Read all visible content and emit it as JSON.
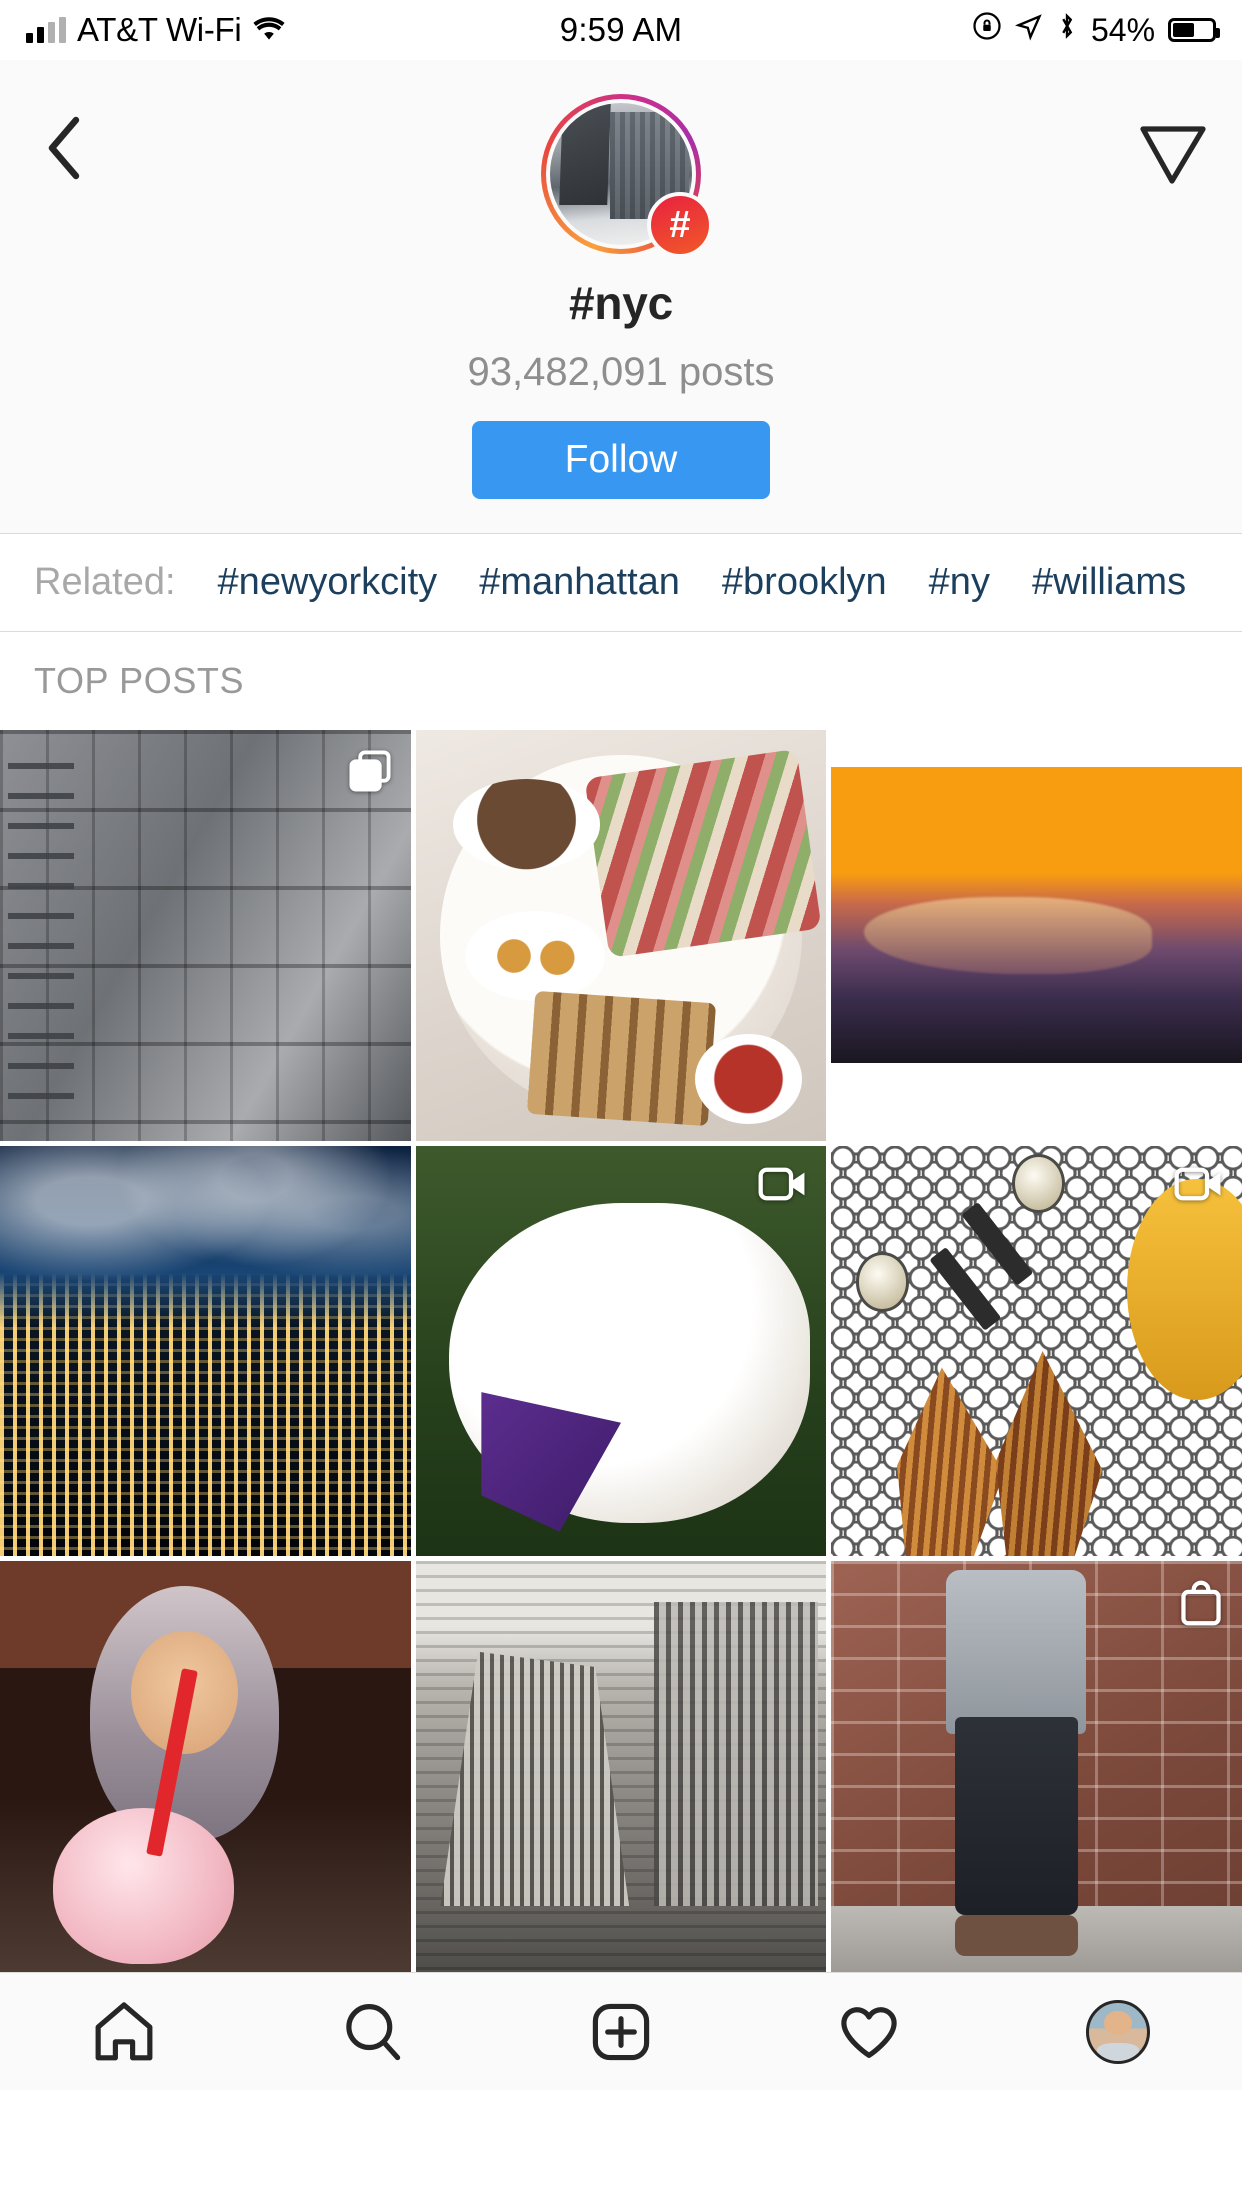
{
  "status_bar": {
    "carrier": "AT&T Wi-Fi",
    "time": "9:59 AM",
    "battery_percent": "54%",
    "icons": [
      "signal-bars-icon",
      "wifi-icon",
      "rotation-lock-icon",
      "location-arrow-icon",
      "bluetooth-icon",
      "battery-icon"
    ]
  },
  "header": {
    "back_icon": "chevron-left-icon",
    "share_icon": "paper-plane-icon",
    "avatar_icon": "hashtag-avatar",
    "badge_glyph": "#",
    "title": "#nyc",
    "post_count": "93,482,091 posts",
    "follow_label": "Follow",
    "follow_color": "#3897f0"
  },
  "related": {
    "label": "Related:",
    "tags": [
      "#newyorkcity",
      "#manhattan",
      "#brooklyn",
      "#ny",
      "#williams"
    ],
    "tag_color": "#1c3f5e"
  },
  "section": {
    "top_posts_label": "TOP POSTS"
  },
  "grid": {
    "posts": [
      {
        "name": "post-building-facade",
        "art": "art-building",
        "overlay": "carousel-icon"
      },
      {
        "name": "post-food-platter",
        "art": "art-food",
        "overlay": "none"
      },
      {
        "name": "post-sunset-wave",
        "art": "art-wave",
        "overlay": "none"
      },
      {
        "name": "post-night-skyline",
        "art": "art-skyline",
        "overlay": "none"
      },
      {
        "name": "post-white-cat",
        "art": "art-cat",
        "overlay": "video-icon"
      },
      {
        "name": "post-hex-tile-shoes",
        "art": "art-tile",
        "overlay": "video-icon"
      },
      {
        "name": "post-woman-drink",
        "art": "art-person",
        "overlay": "none"
      },
      {
        "name": "post-vintage-cityscape",
        "art": "art-vintage",
        "overlay": "none"
      },
      {
        "name": "post-man-brick-wall",
        "art": "art-brick",
        "overlay": "shopping-bag-icon"
      }
    ]
  },
  "tabbar": {
    "items": [
      {
        "name": "tab-home",
        "icon": "home-icon"
      },
      {
        "name": "tab-search",
        "icon": "search-icon"
      },
      {
        "name": "tab-add-post",
        "icon": "plus-square-icon"
      },
      {
        "name": "tab-activity",
        "icon": "heart-icon"
      },
      {
        "name": "tab-profile",
        "icon": "profile-avatar-icon"
      }
    ]
  }
}
